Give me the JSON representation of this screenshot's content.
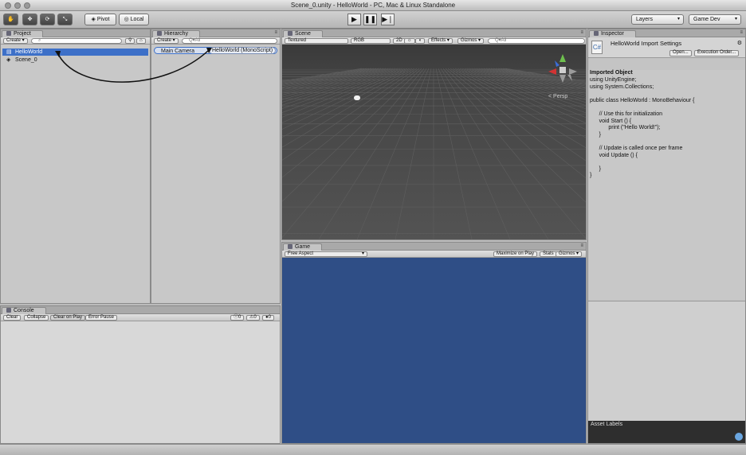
{
  "window": {
    "title": "Scene_0.unity - HelloWorld - PC, Mac & Linux Standalone"
  },
  "toolbar": {
    "tools": [
      "hand-icon",
      "move-icon",
      "rotate-icon",
      "scale-icon"
    ],
    "pivot_label": "Pivot",
    "local_label": "Local",
    "layers_label": "Layers",
    "layout_label": "Game Dev"
  },
  "project": {
    "tab": "Project",
    "create_label": "Create",
    "items": [
      {
        "label": "HelloWorld",
        "selected": true,
        "icon": "script-icon"
      },
      {
        "label": "Scene_0",
        "selected": false,
        "icon": "unity-scene-icon"
      }
    ]
  },
  "hierarchy": {
    "tab": "Hierarchy",
    "create_label": "Create",
    "search_placeholder": "Q▾All",
    "items": [
      {
        "label": "Main Camera"
      }
    ],
    "drag_label": "HelloWorld (MonoScript)"
  },
  "scene": {
    "tab": "Scene",
    "shading": "Textured",
    "render_mode": "RGB",
    "toggle_2d": "2D",
    "effects": "Effects",
    "gizmos": "Gizmos",
    "search_placeholder": "Q▾All",
    "persp_label": "< Persp"
  },
  "game": {
    "tab": "Game",
    "aspect": "Free Aspect",
    "maximize_label": "Maximize on Play",
    "stats_label": "Stats",
    "gizmos_label": "Gizmos",
    "bg_color": "#2f4e86"
  },
  "console": {
    "tab": "Console",
    "buttons": [
      "Clear",
      "Collapse",
      "Clear on Play",
      "Error Pause"
    ],
    "counts": [
      "0",
      "0",
      "0"
    ]
  },
  "inspector": {
    "tab": "Inspector",
    "title": "HelloWorld Import Settings",
    "open_label": "Open...",
    "execution_order_label": "Execution Order...",
    "imported_object_label": "Imported Object",
    "code": "using UnityEngine;\nusing System.Collections;\n\npublic class HelloWorld : MonoBehaviour {\n\n      // Use this for initialization\n      void Start () {\n            print (\"Hello World!\");\n      }\n\n      // Update is called once per frame\n      void Update () {\n\n      }\n}",
    "asset_labels": "Asset Labels"
  }
}
